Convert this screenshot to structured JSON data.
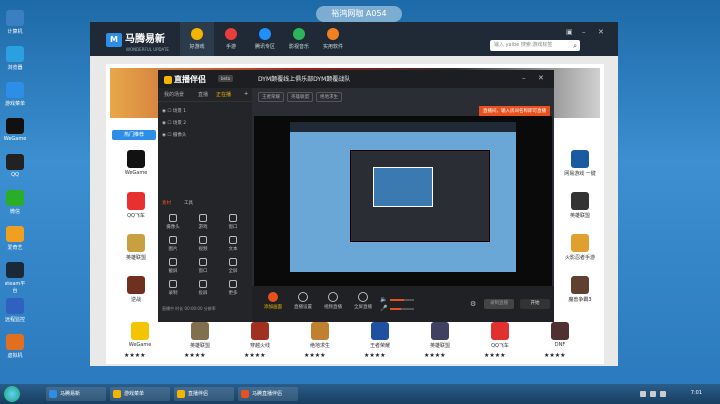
{
  "window_title": "裕鸿网咖 A054",
  "desktop_icons": [
    {
      "label": "计算机",
      "icon": "computer-icon",
      "color": "#3a7fc2"
    },
    {
      "label": "浏览器",
      "icon": "browser-icon",
      "color": "#2aa0e0"
    },
    {
      "label": "游戏菜单",
      "icon": "m-logo-icon",
      "color": "#2d8ee8"
    },
    {
      "label": "WeGame",
      "icon": "wegame-icon",
      "color": "#111111"
    },
    {
      "label": "QQ",
      "icon": "qq-icon",
      "color": "#222222"
    },
    {
      "label": "微信",
      "icon": "wechat-icon",
      "color": "#2aae2a"
    },
    {
      "label": "爱奇艺",
      "icon": "w-icon",
      "color": "#f0a020"
    },
    {
      "label": "steam平台",
      "icon": "steam-icon",
      "color": "#1b2838"
    },
    {
      "label": "远程监控",
      "icon": "monitor-icon",
      "color": "#3060c0"
    },
    {
      "label": "虚拟机",
      "icon": "arrow-icon",
      "color": "#e07020"
    }
  ],
  "app": {
    "logo": "马腾易新",
    "logo_sub": "WONDERFUL UPDATE",
    "nav": [
      {
        "label": "好游戏",
        "color": "#f5b400"
      },
      {
        "label": "手游",
        "color": "#e83e3e"
      },
      {
        "label": "腾讯专区",
        "color": "#1f8fff"
      },
      {
        "label": "影视音乐",
        "color": "#2ab55a"
      },
      {
        "label": "实用软件",
        "color": "#f08020"
      }
    ],
    "search_placeholder": "输入 yaibe 搜索 游戏标签",
    "hot_button": "热门推荐",
    "games_left": [
      {
        "name": "WeGame",
        "color": "#111111"
      },
      {
        "name": "QQ飞车",
        "color": "#e83030"
      },
      {
        "name": "英雄联盟",
        "color": "#c8a040"
      },
      {
        "name": "逆战",
        "color": "#703020"
      }
    ],
    "games_right": [
      {
        "name": "网易游戏 一键",
        "color": "#1a5aa0"
      },
      {
        "name": "英雄联盟",
        "color": "#333333"
      },
      {
        "name": "火影忍者手游",
        "color": "#e0a030"
      },
      {
        "name": "魔兽争霸3",
        "color": "#604030"
      }
    ],
    "games_bottom": [
      {
        "name": "WeGame",
        "color": "#f5c400"
      },
      {
        "name": "英雄联盟",
        "color": "#807050"
      },
      {
        "name": "穿越火线",
        "color": "#a03020"
      },
      {
        "name": "绝地求生",
        "color": "#c08030"
      },
      {
        "name": "王者荣耀",
        "color": "#2050a0"
      },
      {
        "name": "英雄联盟",
        "color": "#404060"
      },
      {
        "name": "QQ飞车",
        "color": "#e03030"
      },
      {
        "name": "DNF",
        "color": "#503030"
      }
    ],
    "stars": "★★★★"
  },
  "stream": {
    "logo": "直播伴侣",
    "version": "beta",
    "tabs": [
      "我的场景",
      "直播",
      "正在播"
    ],
    "scenes": [
      "场景 1",
      "场景 2",
      "摄像头"
    ],
    "tools_label_a": "素材",
    "tools_label_b": "工具",
    "tools": [
      "摄像头",
      "游戏",
      "窗口",
      "图片",
      "视频",
      "文本",
      "截屏",
      "窗口",
      "全屏",
      "录制",
      "投屏",
      "更多"
    ],
    "room_title": "DYM颠覆线上俱乐部DYM颠覆战队",
    "room_tag": "直播",
    "sub_tags": [
      "王者荣耀",
      "英雄联盟",
      "绝地求生"
    ],
    "notice": "直播间，输入房间名称即可直播",
    "bottom": [
      {
        "label": "添加画面",
        "live": true
      },
      {
        "label": "直播设置",
        "live": false
      },
      {
        "label": "视频直播",
        "live": false
      },
      {
        "label": "全屏直播",
        "live": false
      }
    ],
    "audio_level": 0.6,
    "mic_level": 0.45,
    "btn_record": "录制直播",
    "btn_start": "开始",
    "footer": "直播中 时长 00:00:00 分辨率"
  },
  "taskbar": {
    "tasks": [
      {
        "label": "马腾易新",
        "color": "#2d8ee8"
      },
      {
        "label": "游戏菜单",
        "color": "#f5b400"
      },
      {
        "label": "直播伴侣",
        "color": "#f5b400"
      },
      {
        "label": "马腾直播伴侣",
        "color": "#e8501e"
      }
    ],
    "clock": "7:01"
  }
}
